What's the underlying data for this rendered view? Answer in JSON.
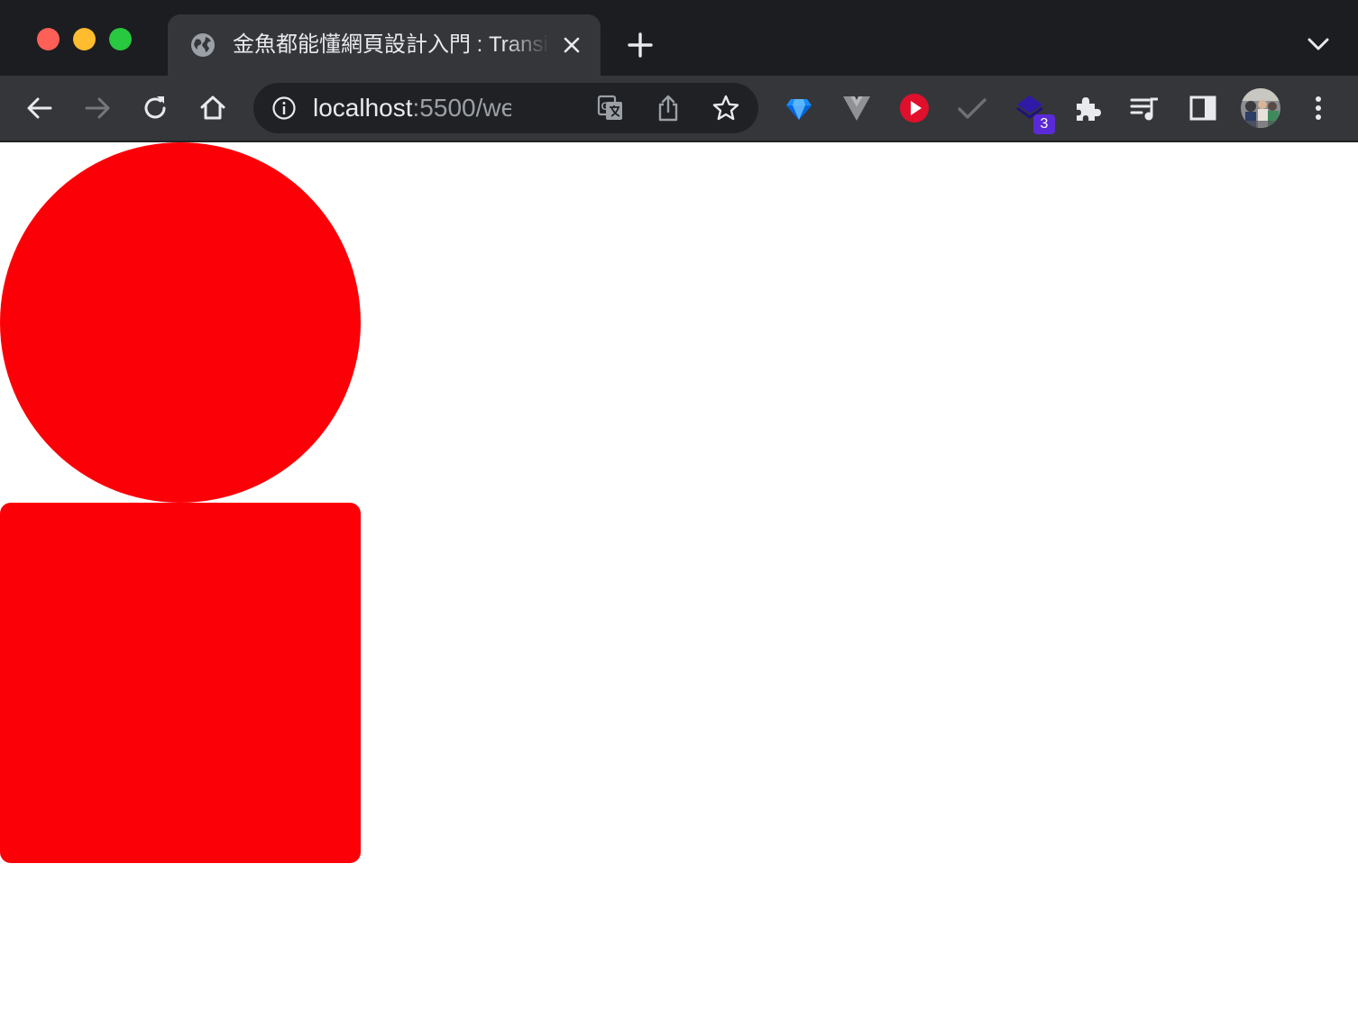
{
  "browser": {
    "tab": {
      "title": "金魚都能懂網頁設計入門 : Transi"
    },
    "address_bar": {
      "host": "localhost",
      "rest": ":5500/web..."
    },
    "extensions": {
      "badge_count": "3"
    }
  },
  "page": {
    "shapes": [
      {
        "kind": "circle",
        "color": "#fc0007"
      },
      {
        "kind": "rounded-square",
        "color": "#fc0007"
      }
    ]
  },
  "icons": [
    "globe-icon",
    "close-icon",
    "plus-icon",
    "chevron-down-icon",
    "back-arrow-icon",
    "forward-arrow-icon",
    "reload-icon",
    "home-icon",
    "info-icon",
    "translate-icon",
    "share-icon",
    "star-icon",
    "gem-icon",
    "vue-icon",
    "play-icon",
    "check-icon",
    "layers-icon",
    "puzzle-icon",
    "playlist-icon",
    "side-panel-icon",
    "avatar",
    "more-vert-icon"
  ]
}
